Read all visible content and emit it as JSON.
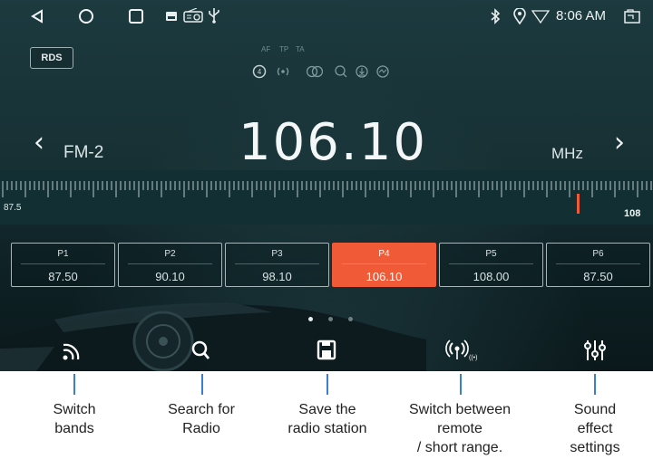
{
  "status_bar": {
    "time": "8:06 AM",
    "icons": [
      "back-triangle-icon",
      "home-circle-icon",
      "recents-square-icon",
      "picture-icon",
      "radio-icon",
      "usb-icon",
      "bluetooth-icon",
      "location-icon",
      "wifi-icon",
      "screenshot-icon"
    ]
  },
  "rds": {
    "label": "RDS"
  },
  "af_labels": {
    "af": "AF",
    "tp": "TP",
    "ta": "TA"
  },
  "radio": {
    "band": "FM-2",
    "frequency": "106.10",
    "unit": "MHz",
    "range_low": "87.5",
    "range_high": "108",
    "indicator_fraction": 0.9
  },
  "presets": [
    {
      "name": "P1",
      "freq": "87.50",
      "active": false
    },
    {
      "name": "P2",
      "freq": "90.10",
      "active": false
    },
    {
      "name": "P3",
      "freq": "98.10",
      "active": false
    },
    {
      "name": "P4",
      "freq": "106.10",
      "active": true
    },
    {
      "name": "P5",
      "freq": "108.00",
      "active": false
    },
    {
      "name": "P6",
      "freq": "87.50",
      "active": false
    }
  ],
  "pager": {
    "pages": 3,
    "current": 1
  },
  "bottom_buttons": [
    {
      "icon": "switch-bands-icon"
    },
    {
      "icon": "search-icon"
    },
    {
      "icon": "save-icon"
    },
    {
      "icon": "remote-range-icon"
    },
    {
      "icon": "equalizer-icon"
    }
  ],
  "captions": {
    "switch_bands": "Switch\nbands",
    "search": "Search for\nRadio",
    "save": "Save the\nradio station",
    "range": "Switch between\nremote\n/ short range.",
    "sound": "Sound\neffect\nsettings"
  },
  "colors": {
    "accent": "#f05a36",
    "callout": "#3a7fd0",
    "background": "#173034"
  }
}
